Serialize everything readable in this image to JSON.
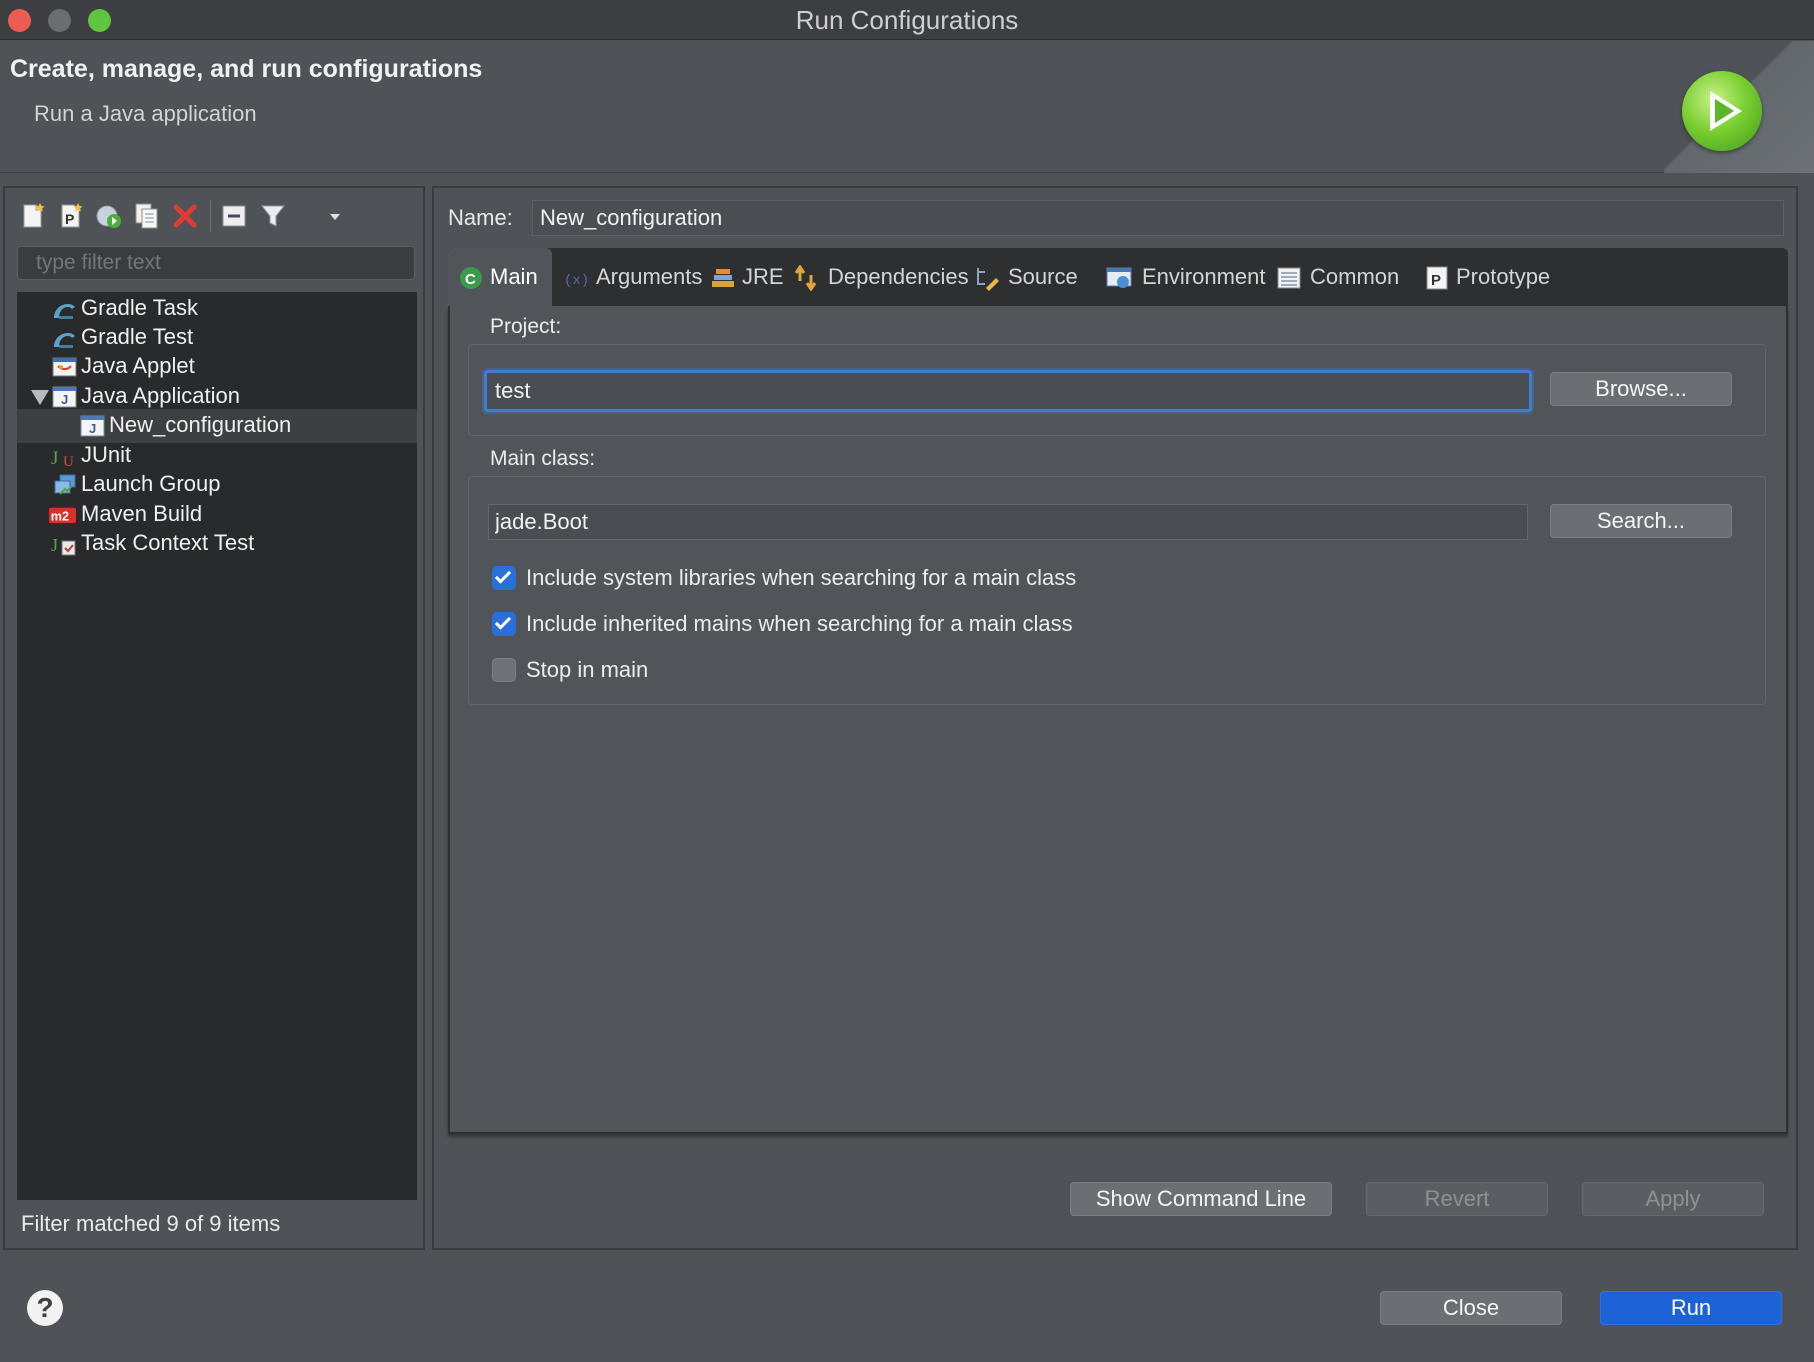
{
  "window": {
    "title": "Run Configurations"
  },
  "header": {
    "title": "Create, manage, and run configurations",
    "subtitle": "Run a Java application",
    "icon": "run-play-icon"
  },
  "left": {
    "toolbar_icons": [
      "new-launch-configuration-icon",
      "new-prototype-icon",
      "export-icon",
      "duplicate-icon",
      "delete-icon",
      "collapse-all-icon",
      "filter-icon"
    ],
    "filter_placeholder": "type filter text",
    "tree": [
      {
        "label": "Gradle Task",
        "icon": "gradle-icon"
      },
      {
        "label": "Gradle Test",
        "icon": "gradle-icon"
      },
      {
        "label": "Java Applet",
        "icon": "java-applet-icon"
      },
      {
        "label": "Java Application",
        "icon": "java-application-icon",
        "expanded": true
      },
      {
        "label": "New_configuration",
        "icon": "java-application-icon",
        "selected": true
      },
      {
        "label": "JUnit",
        "icon": "junit-icon"
      },
      {
        "label": "Launch Group",
        "icon": "launch-group-icon"
      },
      {
        "label": "Maven Build",
        "icon": "maven-icon"
      },
      {
        "label": "Task Context Test",
        "icon": "task-context-test-icon"
      }
    ],
    "status": "Filter matched 9 of 9 items"
  },
  "right": {
    "name_label": "Name:",
    "name_value": "New_configuration",
    "tabs": [
      {
        "label": "Main",
        "icon": "main-class-icon",
        "active": true
      },
      {
        "label": "Arguments",
        "icon": "arguments-icon"
      },
      {
        "label": "JRE",
        "icon": "jre-library-icon"
      },
      {
        "label": "Dependencies",
        "icon": "dependencies-icon"
      },
      {
        "label": "Source",
        "icon": "source-lookup-icon"
      },
      {
        "label": "Environment",
        "icon": "environment-icon"
      },
      {
        "label": "Common",
        "icon": "common-icon"
      },
      {
        "label": "Prototype",
        "icon": "prototype-icon"
      }
    ],
    "project": {
      "label": "Project:",
      "value": "test",
      "browse": "Browse..."
    },
    "main_class": {
      "label": "Main class:",
      "value": "jade.Boot",
      "search": "Search..."
    },
    "checkboxes": [
      {
        "label": "Include system libraries when searching for a main class",
        "checked": true
      },
      {
        "label": "Include inherited mains when searching for a main class",
        "checked": true
      },
      {
        "label": "Stop in main",
        "checked": false
      }
    ],
    "buttons": {
      "show_command_line": "Show Command Line",
      "revert": "Revert",
      "apply": "Apply"
    }
  },
  "footer": {
    "help": "?",
    "close": "Close",
    "run": "Run"
  },
  "colors": {
    "accent": "#1d62d6",
    "focus": "#3f7ecf",
    "background": "#4f5357"
  }
}
